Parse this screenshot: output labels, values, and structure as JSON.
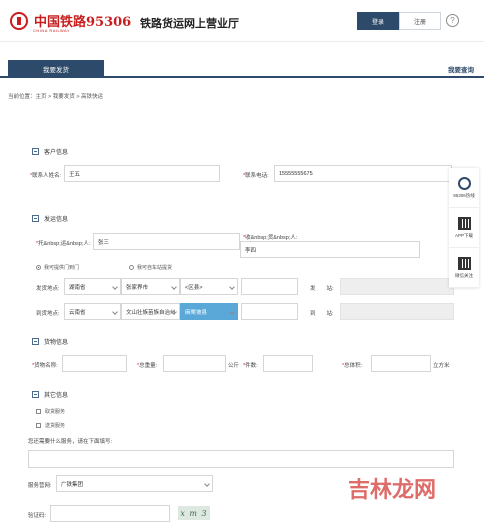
{
  "header": {
    "logo_text": "中国铁路95306",
    "logo_sub": "CHINA RAILWAY",
    "site_title": "铁路货运网上营业厅",
    "login_label": "登录",
    "register_label": "注册",
    "help_glyph": "?"
  },
  "nav": {
    "active_tab": "我要发货",
    "query_link": "我要查询"
  },
  "breadcrumb": "当前位置：主页 > 我要发货 > 高铁快运",
  "customer": {
    "section_title": "客户信息",
    "contact_label": "联系人姓名:",
    "contact_value": "王五",
    "phone_label": "联系电话:",
    "phone_value": "15555555675"
  },
  "shipping": {
    "section_title": "发运信息",
    "sender_label": "托&nbsp;运&nbsp;人:",
    "sender_value": "张三",
    "receiver_label": "收&nbsp;货&nbsp;人:",
    "receiver_value": "李四",
    "radio_door_label": "我可提供门到门",
    "radio_station_label": "我可自车站提货",
    "origin_label": "发货地点:",
    "origin_province": "湖南省",
    "origin_city": "张家界市",
    "origin_district": "<区县>",
    "station_from_label": "发　　站:",
    "dest_label": "到货地点:",
    "dest_province": "云南省",
    "dest_city": "文山壮族苗族自治州",
    "dest_district": "麻栗坡县",
    "station_to_label": "到　　站:"
  },
  "goods": {
    "section_title": "货物信息",
    "name_label": "货物名称:",
    "weight_label": "总重量:",
    "weight_unit": "公斤",
    "count_label": "件数:",
    "volume_label": "总体积:",
    "volume_unit": "立方米"
  },
  "other": {
    "section_title": "其它信息",
    "opt1": "取货服务",
    "opt2": "送货服务",
    "remark_label": "您还需要什么服务，请在下面填写:",
    "branch_label": "服务营网:",
    "branch_value": "广铁集团",
    "captcha_label": "验证码:",
    "captcha_text": "x m 3"
  },
  "side": {
    "hotline": "95306热线",
    "app": "APP下载",
    "wechat": "微信关注"
  },
  "watermark": "吉林龙网",
  "colors": {
    "primary": "#2d4a6a",
    "brand_red": "#c81e1e",
    "highlight": "#5aa8d8"
  }
}
